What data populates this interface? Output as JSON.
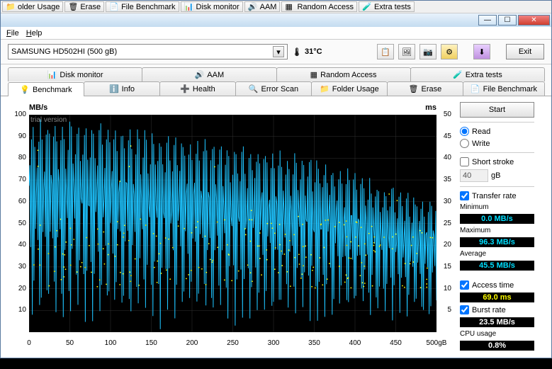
{
  "titlebuttons": {
    "min": "—",
    "max": "☐",
    "close": "✕"
  },
  "menu": {
    "file": "File",
    "help": "Help"
  },
  "hidden_tabs": [
    "older Usage",
    "Erase",
    "File Benchmark",
    "Disk monitor",
    "AAM",
    "Random Access",
    "Extra tests"
  ],
  "drive_combo": "SAMSUNG HD502HI (500 gB)",
  "temp": "31°C",
  "exit": "Exit",
  "tabs_top": [
    {
      "label": "Disk monitor"
    },
    {
      "label": "AAM"
    },
    {
      "label": "Random Access"
    },
    {
      "label": "Extra tests"
    }
  ],
  "tabs_bottom": [
    {
      "label": "Benchmark"
    },
    {
      "label": "Info"
    },
    {
      "label": "Health"
    },
    {
      "label": "Error Scan"
    },
    {
      "label": "Folder Usage"
    },
    {
      "label": "Erase"
    },
    {
      "label": "File Benchmark"
    }
  ],
  "side": {
    "start": "Start",
    "read": "Read",
    "write": "Write",
    "short_stroke": "Short stroke",
    "short_stroke_val": "40",
    "short_stroke_unit": "gB",
    "transfer_rate": "Transfer rate",
    "minimum": "Minimum",
    "min_val": "0.0 MB/s",
    "maximum": "Maximum",
    "max_val": "96.3 MB/s",
    "average": "Average",
    "avg_val": "45.5 MB/s",
    "access_time": "Access time",
    "access_val": "69.0 ms",
    "burst_rate": "Burst rate",
    "burst_val": "23.5 MB/s",
    "cpu_usage": "CPU usage",
    "cpu_val": "0.8%"
  },
  "chart": {
    "ylabel": "MB/s",
    "y2label": "ms",
    "watermark": "trial version",
    "xunit": "500gB"
  },
  "chart_data": {
    "type": "line",
    "title": "",
    "xlabel": "gB",
    "ylabel": "MB/s",
    "y2label": "ms",
    "xlim": [
      0,
      500
    ],
    "ylim": [
      0,
      100
    ],
    "y2lim": [
      0,
      50
    ],
    "xticks": [
      0,
      50,
      100,
      150,
      200,
      250,
      300,
      350,
      400,
      450
    ],
    "yticks": [
      10,
      20,
      30,
      40,
      50,
      60,
      70,
      80,
      90,
      100
    ],
    "y2ticks": [
      5,
      10,
      15,
      20,
      25,
      30,
      35,
      40,
      45,
      50
    ],
    "series": [
      {
        "name": "Transfer rate (MB/s)",
        "color": "#00bfff",
        "axis": "y",
        "note": "dense oscillating line; envelope declines from ~95 MB/s at 0gB to ~55 MB/s at 500gB; troughs near 0-10 MB/s throughout",
        "envelope_upper": [
          [
            0,
            95
          ],
          [
            50,
            95
          ],
          [
            100,
            94
          ],
          [
            150,
            90
          ],
          [
            200,
            88
          ],
          [
            250,
            85
          ],
          [
            300,
            82
          ],
          [
            350,
            78
          ],
          [
            400,
            72
          ],
          [
            450,
            65
          ],
          [
            500,
            58
          ]
        ],
        "envelope_lower": [
          [
            0,
            2
          ],
          [
            500,
            2
          ]
        ]
      },
      {
        "name": "Access time (ms)",
        "color": "#ffff00",
        "axis": "y2",
        "note": "scattered points mostly between 10-25 ms band across full range, avg ~69ms reported in stats"
      }
    ],
    "stats": {
      "min_mbps": 0.0,
      "max_mbps": 96.3,
      "avg_mbps": 45.5,
      "access_ms": 69.0,
      "burst_mbps": 23.5,
      "cpu_pct": 0.8
    }
  }
}
